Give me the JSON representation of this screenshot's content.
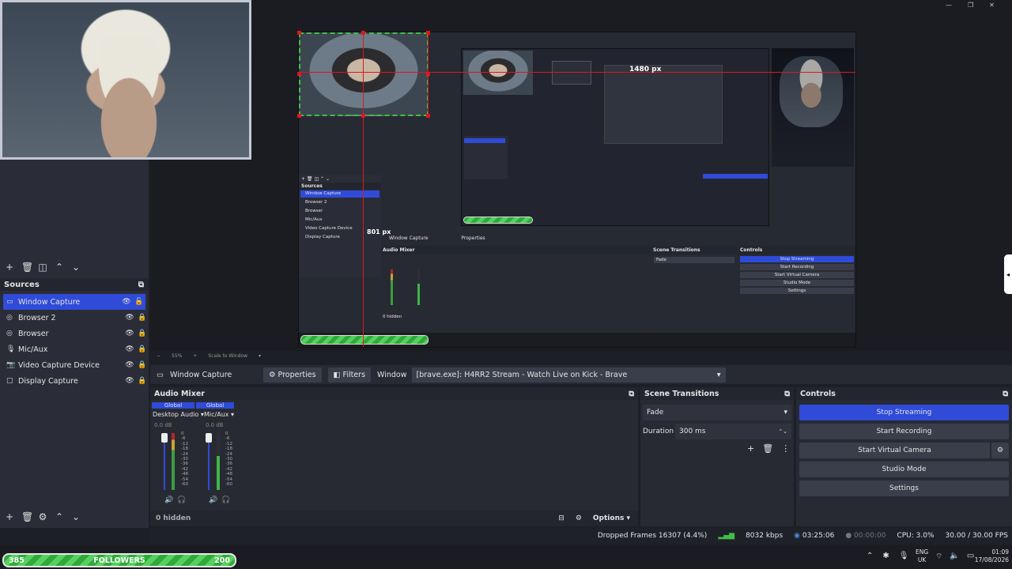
{
  "scene_toolbar": {
    "add": "+",
    "remove": "🗑",
    "filter": "◫",
    "up": "⌃",
    "down": "⌄"
  },
  "sources": {
    "title": "Sources",
    "items": [
      {
        "label": "Window Capture",
        "icon": "window-icon",
        "selected": true
      },
      {
        "label": "Browser 2",
        "icon": "globe-icon"
      },
      {
        "label": "Browser",
        "icon": "globe-icon"
      },
      {
        "label": "Mic/Aux",
        "icon": "mic-icon"
      },
      {
        "label": "Video Capture Device",
        "icon": "camera-icon"
      },
      {
        "label": "Display Capture",
        "icon": "display-icon"
      }
    ]
  },
  "preview": {
    "dim_label": "1480 px",
    "dim_label2": "801 px",
    "zoom": "55%",
    "scale_label": "Scale to Window"
  },
  "properties_bar": {
    "source_name": "Window Capture",
    "properties": "Properties",
    "filters": "Filters",
    "window_label": "Window",
    "window_value": "[brave.exe]: H4RR2 Stream - Watch Live on Kick - Brave"
  },
  "audio_mixer": {
    "title": "Audio Mixer",
    "channels": [
      {
        "global": "Global",
        "name": "Desktop Audio",
        "db": "0.0 dB",
        "level": 0.85
      },
      {
        "global": "Global",
        "name": "Mic/Aux",
        "db": "0.0 dB",
        "level": 0.55
      }
    ],
    "ticks": [
      "0",
      "-6",
      "-12",
      "-18",
      "-24",
      "-30",
      "-36",
      "-42",
      "-48",
      "-54",
      "-60"
    ],
    "hidden": "0 hidden",
    "options": "Options"
  },
  "scene_transitions": {
    "title": "Scene Transitions",
    "transition": "Fade",
    "duration_label": "Duration",
    "duration_value": "300 ms"
  },
  "controls": {
    "title": "Controls",
    "stop_streaming": "Stop Streaming",
    "start_recording": "Start Recording",
    "start_virtual_camera": "Start Virtual Camera",
    "studio_mode": "Studio Mode",
    "settings": "Settings"
  },
  "status": {
    "dropped": "Dropped Frames 16307 (4.4%)",
    "kbps": "8032 kbps",
    "stream_time": "03:25:06",
    "rec_time": "00:00:00",
    "cpu": "CPU: 3.0%",
    "fps": "30.00 / 30.00 FPS"
  },
  "followers": {
    "left": "385",
    "label": "FOLLOWERS",
    "right": "200"
  },
  "tray": {
    "lang": "ENG",
    "region": "UK",
    "time": "01:09",
    "date": "17/08/2026"
  },
  "colors": {
    "accent": "#2f4bd8",
    "guide": "#e0161c",
    "bg": "#1d1f26"
  }
}
